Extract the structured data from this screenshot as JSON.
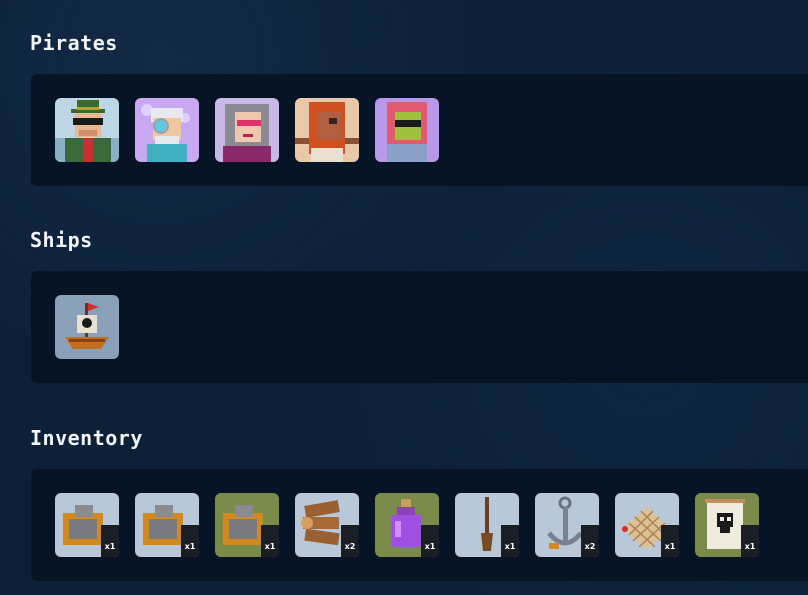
{
  "sections": {
    "pirates": {
      "title": "Pirates",
      "items": [
        {
          "icon": "pirate-captain-green-hat",
          "bg": "#bcd6e6"
        },
        {
          "icon": "pirate-goggles-white-hair",
          "bg": "#c8a8f0"
        },
        {
          "icon": "pirate-woman-pink-glasses",
          "bg": "#c8b8e8"
        },
        {
          "icon": "pirate-red-hair",
          "bg": "#e8c8a8"
        },
        {
          "icon": "pirate-zombie-pink-hair",
          "bg": "#b898e8"
        }
      ]
    },
    "ships": {
      "title": "Ships",
      "items": [
        {
          "icon": "pirate-ship",
          "bg": "#b8c8d8"
        }
      ]
    },
    "inventory": {
      "title": "Inventory",
      "items": [
        {
          "icon": "cannon-chest",
          "bg": "#b8c8d8",
          "qty": "x1"
        },
        {
          "icon": "cannon-chest",
          "bg": "#b8c8d8",
          "qty": "x1"
        },
        {
          "icon": "cannon-chest",
          "bg": "#7a8a4a",
          "qty": "x1"
        },
        {
          "icon": "wood-logs",
          "bg": "#b8c8d8",
          "qty": "x2"
        },
        {
          "icon": "purple-potion",
          "bg": "#7a8a4a",
          "qty": "x1"
        },
        {
          "icon": "oar",
          "bg": "#b8c8d8",
          "qty": "x1"
        },
        {
          "icon": "anchor",
          "bg": "#b8c8d8",
          "qty": "x2"
        },
        {
          "icon": "fishing-net",
          "bg": "#b8c8d8",
          "qty": "x1"
        },
        {
          "icon": "skull-flag",
          "bg": "#7a8a4a",
          "qty": "x1"
        }
      ]
    }
  }
}
